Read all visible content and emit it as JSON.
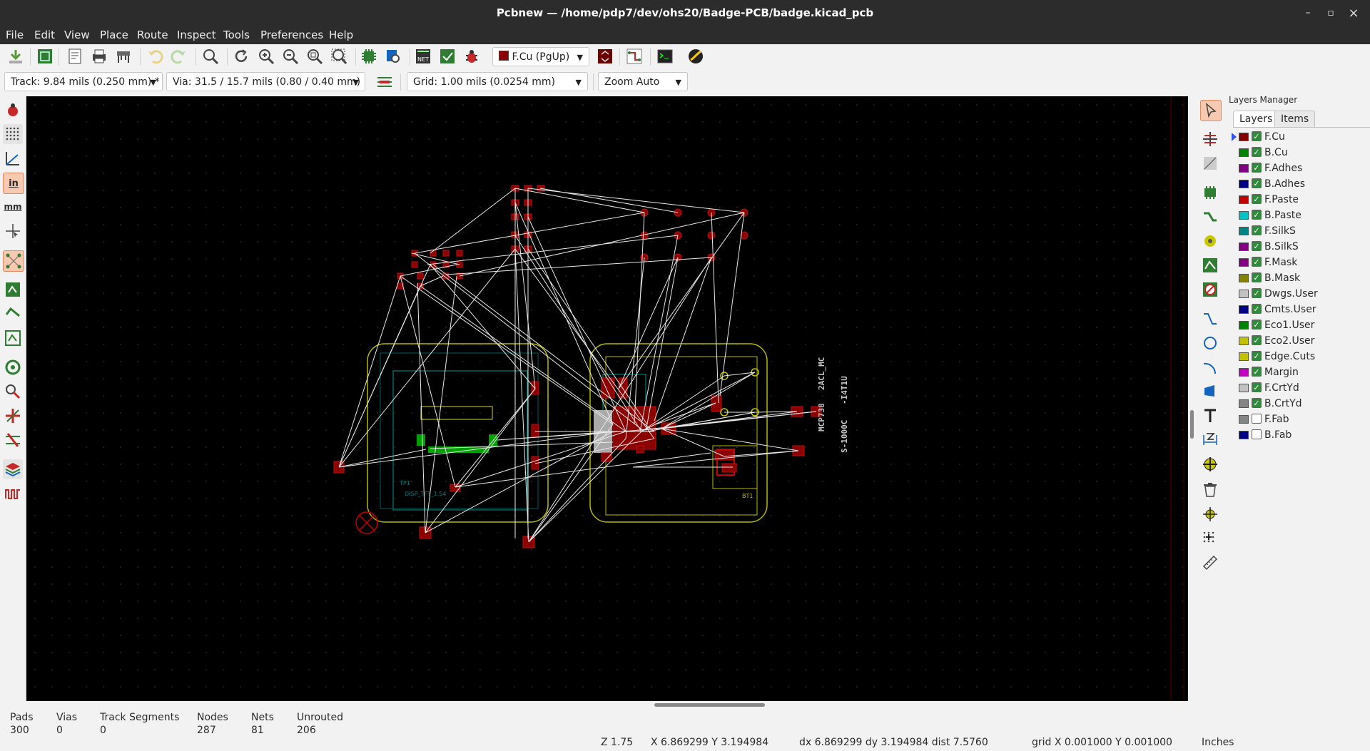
{
  "window": {
    "title": "Pcbnew — /home/pdp7/dev/ohs20/Badge-PCB/badge.kicad_pcb",
    "minimize": "–",
    "maximize": "▫",
    "close": "×"
  },
  "menu": [
    "File",
    "Edit",
    "View",
    "Place",
    "Route",
    "Inspect",
    "Tools",
    "Preferences",
    "Help"
  ],
  "toolbar": {
    "layer_select": "F.Cu (PgUp)",
    "layer_color": "#8b0000",
    "track": "Track: 9.84 mils (0.250 mm) *",
    "via": "Via: 31.5 / 15.7 mils (0.80 / 0.40 mm) *",
    "grid": "Grid: 1.00 mils (0.0254 mm)",
    "zoom": "Zoom Auto",
    "units_in": "in",
    "units_mm": "mm"
  },
  "layers_manager": {
    "title": "Layers Manager",
    "tabs": [
      "Layers",
      "Items"
    ],
    "active_tab": "Layers",
    "layers": [
      {
        "name": "F.Cu",
        "color": "#840000",
        "checked": true,
        "selected": true
      },
      {
        "name": "B.Cu",
        "color": "#008400",
        "checked": true
      },
      {
        "name": "F.Adhes",
        "color": "#840084",
        "checked": true
      },
      {
        "name": "B.Adhes",
        "color": "#000084",
        "checked": true
      },
      {
        "name": "F.Paste",
        "color": "#c20000",
        "checked": true
      },
      {
        "name": "B.Paste",
        "color": "#00c2c2",
        "checked": true
      },
      {
        "name": "F.SilkS",
        "color": "#008484",
        "checked": true
      },
      {
        "name": "B.SilkS",
        "color": "#840084",
        "checked": true
      },
      {
        "name": "F.Mask",
        "color": "#840084",
        "checked": true
      },
      {
        "name": "B.Mask",
        "color": "#848400",
        "checked": true
      },
      {
        "name": "Dwgs.User",
        "color": "#c2c2c2",
        "checked": true
      },
      {
        "name": "Cmts.User",
        "color": "#000084",
        "checked": true
      },
      {
        "name": "Eco1.User",
        "color": "#008400",
        "checked": true
      },
      {
        "name": "Eco2.User",
        "color": "#c2c200",
        "checked": true
      },
      {
        "name": "Edge.Cuts",
        "color": "#c2c200",
        "checked": true
      },
      {
        "name": "Margin",
        "color": "#c200c2",
        "checked": true
      },
      {
        "name": "F.CrtYd",
        "color": "#c2c2c2",
        "checked": true
      },
      {
        "name": "B.CrtYd",
        "color": "#848484",
        "checked": true
      },
      {
        "name": "F.Fab",
        "color": "#848484",
        "checked": false
      },
      {
        "name": "B.Fab",
        "color": "#000084",
        "checked": false
      }
    ]
  },
  "board_labels": {
    "mcp": "MCP738",
    "mcp2": "2ACL_MC",
    "sw": "S-1000C",
    "sw2": "-I4T1U",
    "disp": "DISP_TFT_1.54",
    "tp1": "TP1",
    "bt1": "BT1"
  },
  "stats": [
    {
      "label": "Pads",
      "value": "300"
    },
    {
      "label": "Vias",
      "value": "0"
    },
    {
      "label": "Track Segments",
      "value": "0"
    },
    {
      "label": "Nodes",
      "value": "287"
    },
    {
      "label": "Nets",
      "value": "81"
    },
    {
      "label": "Unrouted",
      "value": "206"
    }
  ],
  "status": {
    "zoom": "Z 1.75",
    "xy": "X 6.869299  Y 3.194984",
    "delta": "dx 6.869299  dy 3.194984  dist 7.5760",
    "grid": "grid X 0.001000  Y 0.001000",
    "units": "Inches"
  }
}
